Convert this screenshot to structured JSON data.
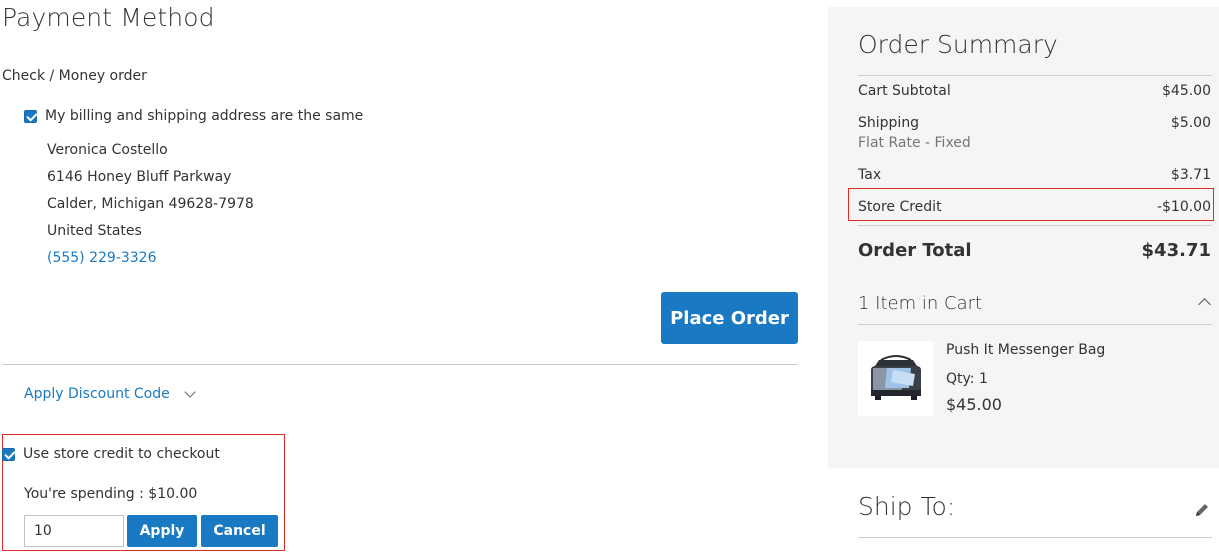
{
  "payment": {
    "title": "Payment Method",
    "method": "Check / Money order",
    "billing_same_label": "My billing and shipping address are the same",
    "billing_same_checked": true,
    "address": {
      "name": "Veronica Costello",
      "street": "6146 Honey Bluff Parkway",
      "city_line": "Calder, Michigan 49628-7978",
      "country": "United States",
      "phone": "(555) 229-3326"
    },
    "place_order_label": "Place Order"
  },
  "discount": {
    "toggle_label": "Apply Discount Code"
  },
  "store_credit": {
    "checkbox_label": "Use store credit to checkout",
    "checked": true,
    "spending_text": "You're spending : $10.00",
    "input_value": "10",
    "apply_label": "Apply",
    "cancel_label": "Cancel"
  },
  "summary": {
    "title": "Order Summary",
    "rows": {
      "subtotal": {
        "label": "Cart Subtotal",
        "value": "$45.00"
      },
      "shipping": {
        "label": "Shipping",
        "method": "Flat Rate - Fixed",
        "value": "$5.00"
      },
      "tax": {
        "label": "Tax",
        "value": "$3.71"
      },
      "store_credit": {
        "label": "Store Credit",
        "value": "-$10.00"
      }
    },
    "total": {
      "label": "Order Total",
      "value": "$43.71"
    },
    "items_toggle": "1 Item in Cart",
    "item": {
      "name": "Push It Messenger Bag",
      "qty": "Qty: 1",
      "price": "$45.00"
    }
  },
  "ship_to": {
    "title": "Ship To:"
  },
  "colors": {
    "accent": "#1979c3",
    "highlight_border": "#e02b27",
    "panel_bg": "#f5f5f5"
  }
}
